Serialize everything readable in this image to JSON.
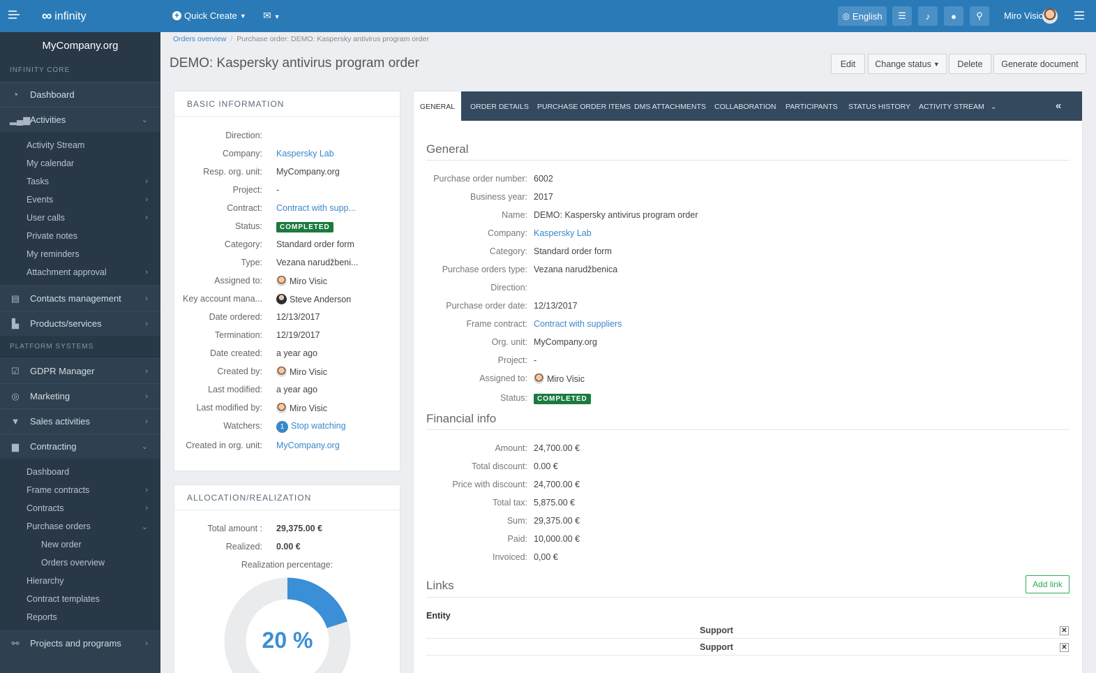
{
  "topbar": {
    "logo": "infinity",
    "quick_create": "Quick Create",
    "language": "English",
    "user_name": "Miro Visic"
  },
  "sidebar": {
    "org": "MyCompany.org",
    "section_core": "INFINITY CORE",
    "dashboard": "Dashboard",
    "activities": "Activities",
    "activities_sub": [
      "Activity Stream",
      "My calendar",
      "Tasks",
      "Events",
      "User calls",
      "Private notes",
      "My reminders",
      "Attachment approval"
    ],
    "contacts": "Contacts management",
    "products": "Products/services",
    "section_platform": "PLATFORM SYSTEMS",
    "gdpr": "GDPR Manager",
    "marketing": "Marketing",
    "sales": "Sales activities",
    "contracting": "Contracting",
    "contracting_sub": [
      "Dashboard",
      "Frame contracts",
      "Contracts",
      "Purchase orders",
      "New order",
      "Orders overview",
      "Hierarchy",
      "Contract templates",
      "Reports"
    ],
    "projects": "Projects and programs"
  },
  "breadcrumb": {
    "parent": "Orders overview",
    "current": "Purchase order: DEMO: Kaspersky antivirus program order"
  },
  "page": {
    "title": "DEMO: Kaspersky antivirus program order",
    "actions": {
      "edit": "Edit",
      "change_status": "Change status",
      "delete": "Delete",
      "generate": "Generate document"
    }
  },
  "basic_info": {
    "title": "BASIC INFORMATION",
    "rows": [
      {
        "k": "Direction:",
        "v": ""
      },
      {
        "k": "Company:",
        "v": "Kaspersky Lab"
      },
      {
        "k": "Resp. org. unit:",
        "v": "MyCompany.org"
      },
      {
        "k": "Project:",
        "v": "-"
      },
      {
        "k": "Contract:",
        "v": "Contract with supp..."
      },
      {
        "k": "Status:",
        "v": "COMPLETED"
      },
      {
        "k": "Category:",
        "v": "Standard order form"
      },
      {
        "k": "Type:",
        "v": "Vezana narudžbeni..."
      },
      {
        "k": "Assigned to:",
        "v": "Miro Visic"
      },
      {
        "k": "Key account mana...",
        "v": "Steve Anderson"
      },
      {
        "k": "Date ordered:",
        "v": "12/13/2017"
      },
      {
        "k": "Termination:",
        "v": "12/19/2017"
      },
      {
        "k": "Date created:",
        "v": "a year ago"
      },
      {
        "k": "Created by:",
        "v": "Miro Visic"
      },
      {
        "k": "Last modified:",
        "v": "a year ago"
      },
      {
        "k": "Last modified by:",
        "v": "Miro Visic"
      },
      {
        "k": "Watchers:",
        "v": "Stop watching"
      },
      {
        "k": "Created in org. unit:",
        "v": "MyCompany.org"
      }
    ],
    "watchers_count": "1"
  },
  "allocation": {
    "title": "ALLOCATION/REALIZATION",
    "total_label": "Total amount :",
    "total_value": "29,375.00 €",
    "realized_label": "Realized:",
    "realized_value": "0.00 €",
    "percentage_label": "Realization percentage:",
    "percentage_text": "20 %",
    "percentage_value": 20
  },
  "tabs": [
    "GENERAL",
    "ORDER DETAILS",
    "PURCHASE ORDER ITEMS",
    "DMS ATTACHMENTS",
    "COLLABORATION",
    "PARTICIPANTS",
    "STATUS HISTORY",
    "ACTIVITY STREAM"
  ],
  "general": {
    "title": "General",
    "rows": [
      {
        "k": "Purchase order number:",
        "v": "6002"
      },
      {
        "k": "Business year:",
        "v": "2017"
      },
      {
        "k": "Name:",
        "v": "DEMO: Kaspersky antivirus program order"
      },
      {
        "k": "Company:",
        "v": "Kaspersky Lab"
      },
      {
        "k": "Category:",
        "v": "Standard order form"
      },
      {
        "k": "Purchase orders type:",
        "v": "Vezana narudžbenica"
      },
      {
        "k": "Direction:",
        "v": ""
      },
      {
        "k": "Purchase order date:",
        "v": "12/13/2017"
      },
      {
        "k": "Frame contract:",
        "v": "Contract with suppliers"
      },
      {
        "k": "Org. unit:",
        "v": "MyCompany.org"
      },
      {
        "k": "Project:",
        "v": "-"
      },
      {
        "k": "Assigned to:",
        "v": "Miro Visic"
      },
      {
        "k": "Status:",
        "v": "COMPLETED"
      }
    ]
  },
  "financial": {
    "title": "Financial info",
    "rows": [
      {
        "k": "Amount:",
        "v": "24,700.00 €"
      },
      {
        "k": "Total discount:",
        "v": "0.00 €"
      },
      {
        "k": "Price with discount:",
        "v": "24,700.00 €"
      },
      {
        "k": "Total tax:",
        "v": "5,875.00 €"
      },
      {
        "k": "Sum:",
        "v": "29,375.00 €"
      },
      {
        "k": "Paid:",
        "v": "10,000.00 €"
      },
      {
        "k": "Invoiced:",
        "v": "0,00 €"
      }
    ]
  },
  "links": {
    "title": "Links",
    "add": "Add link",
    "entity_label": "Entity",
    "items": [
      "Support",
      "Support"
    ]
  },
  "colors": {
    "topbar": "#2a7ab7",
    "sidebar": "#2f4050",
    "tabbar": "#34495e",
    "completed": "#1b7a3f",
    "link": "#3a87c9"
  }
}
